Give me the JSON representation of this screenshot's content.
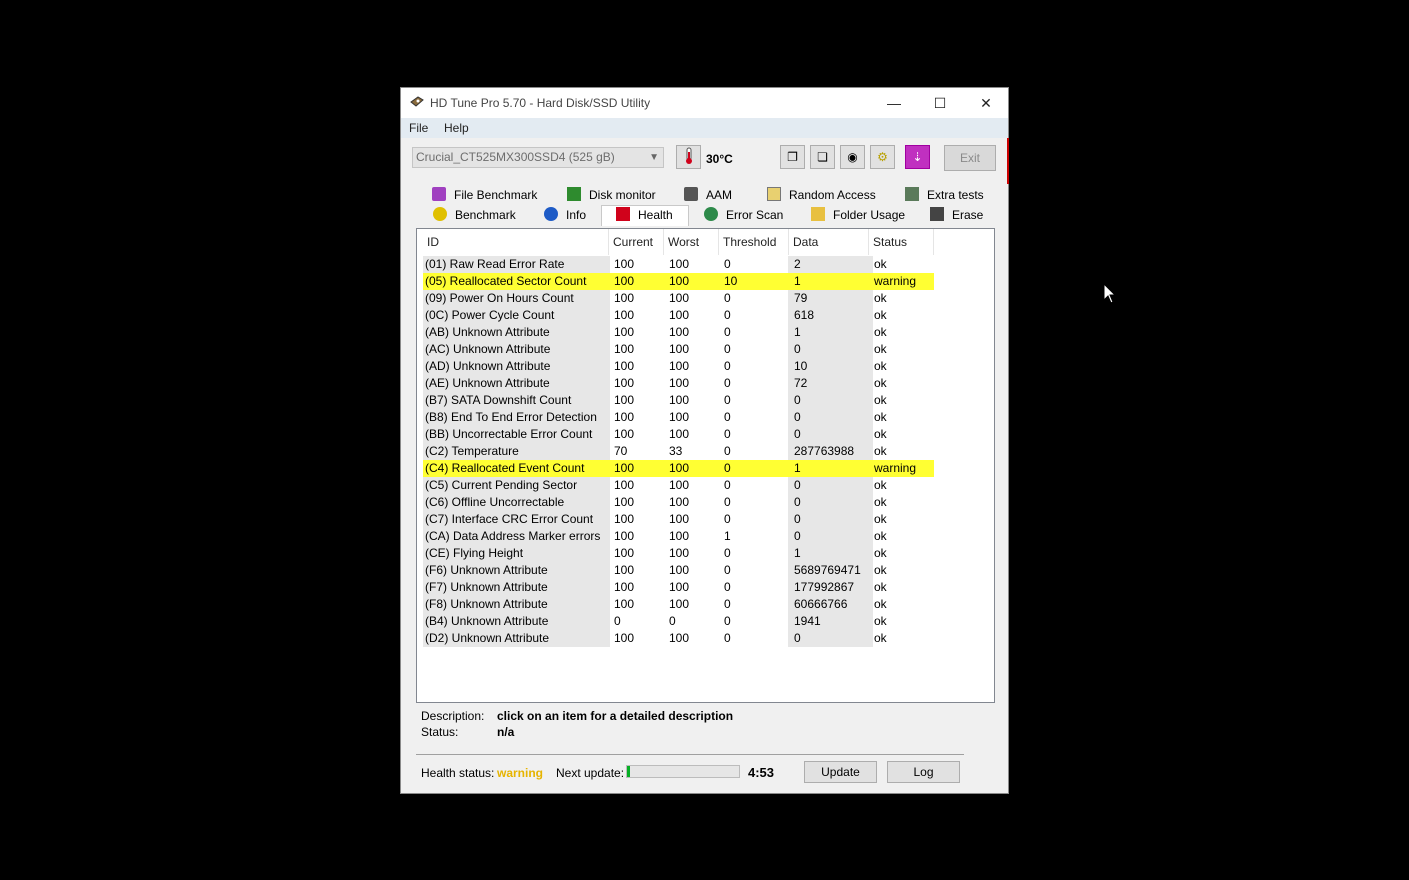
{
  "window": {
    "title": "HD Tune Pro 5.70 - Hard Disk/SSD Utility"
  },
  "menu": [
    "File",
    "Help"
  ],
  "toolbar": {
    "drive": "Crucial_CT525MX300SSD4 (525 gB)",
    "temperature": "30°C",
    "exit_label": "Exit"
  },
  "tabs_top": [
    "File Benchmark",
    "Disk monitor",
    "AAM",
    "Random Access",
    "Extra tests"
  ],
  "tabs_bottom": [
    "Benchmark",
    "Info",
    "Health",
    "Error Scan",
    "Folder Usage",
    "Erase"
  ],
  "selected_tab": "Health",
  "columns": [
    "ID",
    "Current",
    "Worst",
    "Threshold",
    "Data",
    "Status"
  ],
  "rows": [
    {
      "id": "(01) Raw Read Error Rate",
      "current": "100",
      "worst": "100",
      "threshold": "0",
      "data": "2",
      "status": "ok",
      "warn": false
    },
    {
      "id": "(05) Reallocated Sector Count",
      "current": "100",
      "worst": "100",
      "threshold": "10",
      "data": "1",
      "status": "warning",
      "warn": true
    },
    {
      "id": "(09) Power On Hours Count",
      "current": "100",
      "worst": "100",
      "threshold": "0",
      "data": "79",
      "status": "ok",
      "warn": false
    },
    {
      "id": "(0C) Power Cycle Count",
      "current": "100",
      "worst": "100",
      "threshold": "0",
      "data": "618",
      "status": "ok",
      "warn": false
    },
    {
      "id": "(AB) Unknown Attribute",
      "current": "100",
      "worst": "100",
      "threshold": "0",
      "data": "1",
      "status": "ok",
      "warn": false
    },
    {
      "id": "(AC) Unknown Attribute",
      "current": "100",
      "worst": "100",
      "threshold": "0",
      "data": "0",
      "status": "ok",
      "warn": false
    },
    {
      "id": "(AD) Unknown Attribute",
      "current": "100",
      "worst": "100",
      "threshold": "0",
      "data": "10",
      "status": "ok",
      "warn": false
    },
    {
      "id": "(AE) Unknown Attribute",
      "current": "100",
      "worst": "100",
      "threshold": "0",
      "data": "72",
      "status": "ok",
      "warn": false
    },
    {
      "id": "(B7) SATA Downshift Count",
      "current": "100",
      "worst": "100",
      "threshold": "0",
      "data": "0",
      "status": "ok",
      "warn": false
    },
    {
      "id": "(B8) End To End Error Detection",
      "current": "100",
      "worst": "100",
      "threshold": "0",
      "data": "0",
      "status": "ok",
      "warn": false
    },
    {
      "id": "(BB) Uncorrectable Error Count",
      "current": "100",
      "worst": "100",
      "threshold": "0",
      "data": "0",
      "status": "ok",
      "warn": false
    },
    {
      "id": "(C2) Temperature",
      "current": "70",
      "worst": "33",
      "threshold": "0",
      "data": "287763988",
      "status": "ok",
      "warn": false
    },
    {
      "id": "(C4) Reallocated Event Count",
      "current": "100",
      "worst": "100",
      "threshold": "0",
      "data": "1",
      "status": "warning",
      "warn": true
    },
    {
      "id": "(C5) Current Pending Sector",
      "current": "100",
      "worst": "100",
      "threshold": "0",
      "data": "0",
      "status": "ok",
      "warn": false
    },
    {
      "id": "(C6) Offline Uncorrectable",
      "current": "100",
      "worst": "100",
      "threshold": "0",
      "data": "0",
      "status": "ok",
      "warn": false
    },
    {
      "id": "(C7) Interface CRC Error Count",
      "current": "100",
      "worst": "100",
      "threshold": "0",
      "data": "0",
      "status": "ok",
      "warn": false
    },
    {
      "id": "(CA) Data Address Marker errors",
      "current": "100",
      "worst": "100",
      "threshold": "1",
      "data": "0",
      "status": "ok",
      "warn": false
    },
    {
      "id": "(CE) Flying Height",
      "current": "100",
      "worst": "100",
      "threshold": "0",
      "data": "1",
      "status": "ok",
      "warn": false
    },
    {
      "id": "(F6) Unknown Attribute",
      "current": "100",
      "worst": "100",
      "threshold": "0",
      "data": "5689769471",
      "status": "ok",
      "warn": false
    },
    {
      "id": "(F7) Unknown Attribute",
      "current": "100",
      "worst": "100",
      "threshold": "0",
      "data": "177992867",
      "status": "ok",
      "warn": false
    },
    {
      "id": "(F8) Unknown Attribute",
      "current": "100",
      "worst": "100",
      "threshold": "0",
      "data": "60666766",
      "status": "ok",
      "warn": false
    },
    {
      "id": "(B4) Unknown Attribute",
      "current": "0",
      "worst": "0",
      "threshold": "0",
      "data": "1941",
      "status": "ok",
      "warn": false
    },
    {
      "id": "(D2) Unknown Attribute",
      "current": "100",
      "worst": "100",
      "threshold": "0",
      "data": "0",
      "status": "ok",
      "warn": false
    }
  ],
  "details": {
    "description_label": "Description:",
    "description": "click on an item for a detailed description",
    "status_label": "Status:",
    "status": "n/a"
  },
  "footer": {
    "health_label": "Health status:",
    "health_value": "warning",
    "next_update_label": "Next update:",
    "progress_fraction": 0.03,
    "time_left": "4:53",
    "update_label": "Update",
    "log_label": "Log"
  },
  "colors": {
    "warning_row": "#ffff33",
    "warning_text": "#e6b400",
    "progress": "#06b025"
  }
}
